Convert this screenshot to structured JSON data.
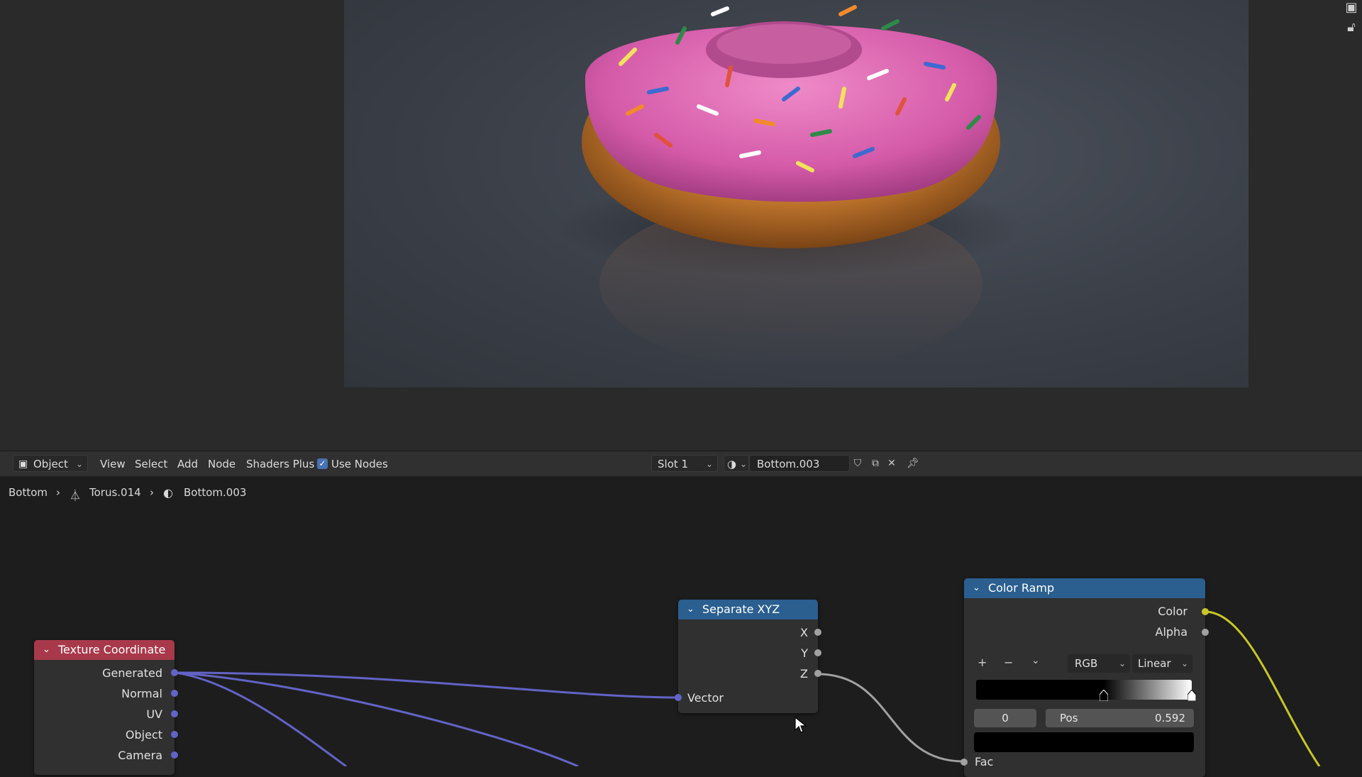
{
  "viewport": {
    "render_alt": "",
    "colors": {
      "frosting": "#d45aa8",
      "dough": "#c67a2e",
      "background": "#3f444c"
    }
  },
  "header": {
    "mode_label": "Object",
    "menu": [
      "View",
      "Select",
      "Add",
      "Node",
      "Shaders Plus"
    ],
    "use_nodes_label": "Use Nodes",
    "use_nodes_checked": true,
    "slot_label": "Slot 1",
    "material_name": "Bottom.003"
  },
  "breadcrumb": {
    "items": [
      "Bottom",
      "Torus.014",
      "Bottom.003"
    ]
  },
  "nodes": {
    "texture_coordinate": {
      "title": "Texture Coordinate",
      "header_color": "#a8394a",
      "outputs": [
        "Generated",
        "Normal",
        "UV",
        "Object",
        "Camera"
      ]
    },
    "separate_xyz": {
      "title": "Separate XYZ",
      "header_color": "#2a5f8f",
      "outputs": [
        "X",
        "Y",
        "Z"
      ],
      "inputs": [
        "Vector"
      ]
    },
    "color_ramp": {
      "title": "Color Ramp",
      "header_color": "#2a5f8f",
      "outputs": [
        "Color",
        "Alpha"
      ],
      "color_mode": "RGB",
      "interpolation": "Linear",
      "add_symbol": "+",
      "remove_symbol": "−",
      "stop_index": "0",
      "pos_label": "Pos",
      "pos_value": "0.592",
      "stop_position": 0.592,
      "inputs": [
        "Fac"
      ]
    }
  },
  "socket_colors": {
    "vector": "#6363c7",
    "float": "#a1a1a1",
    "color": "#c7c729"
  }
}
